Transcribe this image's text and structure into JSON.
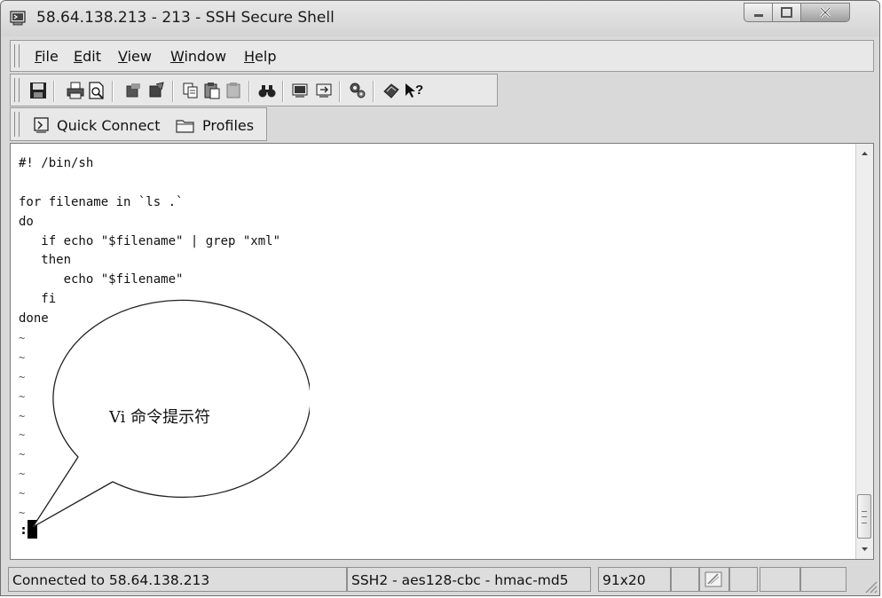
{
  "window": {
    "title": "58.64.138.213 - 213 - SSH Secure Shell",
    "app_icon": "ssh-terminal-icon",
    "controls": [
      "minimize-icon",
      "maximize-icon",
      "close-icon"
    ]
  },
  "menu": {
    "items": [
      {
        "label": "File",
        "mnemonic": "F"
      },
      {
        "label": "Edit",
        "mnemonic": "E"
      },
      {
        "label": "View",
        "mnemonic": "V"
      },
      {
        "label": "Window",
        "mnemonic": "W"
      },
      {
        "label": "Help",
        "mnemonic": "H"
      }
    ]
  },
  "toolbar": {
    "icons": [
      "save-icon",
      "print-icon",
      "print-preview-icon",
      "disconnect-icon",
      "connect-icon",
      "copy-icon",
      "paste-icon",
      "paste-disabled-icon",
      "find-icon",
      "new-terminal-icon",
      "new-file-transfer-icon",
      "settings-icon",
      "help-book-icon",
      "context-help-icon"
    ]
  },
  "connectbar": {
    "quick_connect_label": "Quick Connect",
    "profiles_label": "Profiles"
  },
  "terminal": {
    "lines": [
      "#! /bin/sh",
      "",
      "for filename in `ls .`",
      "do",
      "   if echo \"$filename\" | grep \"xml\"",
      "   then",
      "      echo \"$filename\"",
      "   fi",
      "done",
      "~",
      "~",
      "~",
      "~",
      "~",
      "~",
      "~",
      "~",
      "~",
      "~"
    ],
    "prompt": ":"
  },
  "annotation": {
    "text": "Vi 命令提示符"
  },
  "status": {
    "connection": "Connected to 58.64.138.213",
    "encryption": "SSH2 - aes128-cbc - hmac-md5",
    "size": "91x20"
  },
  "colors": {
    "chrome": "#d9d9d9",
    "terminal_bg": "#ffffff",
    "text": "#111111"
  }
}
